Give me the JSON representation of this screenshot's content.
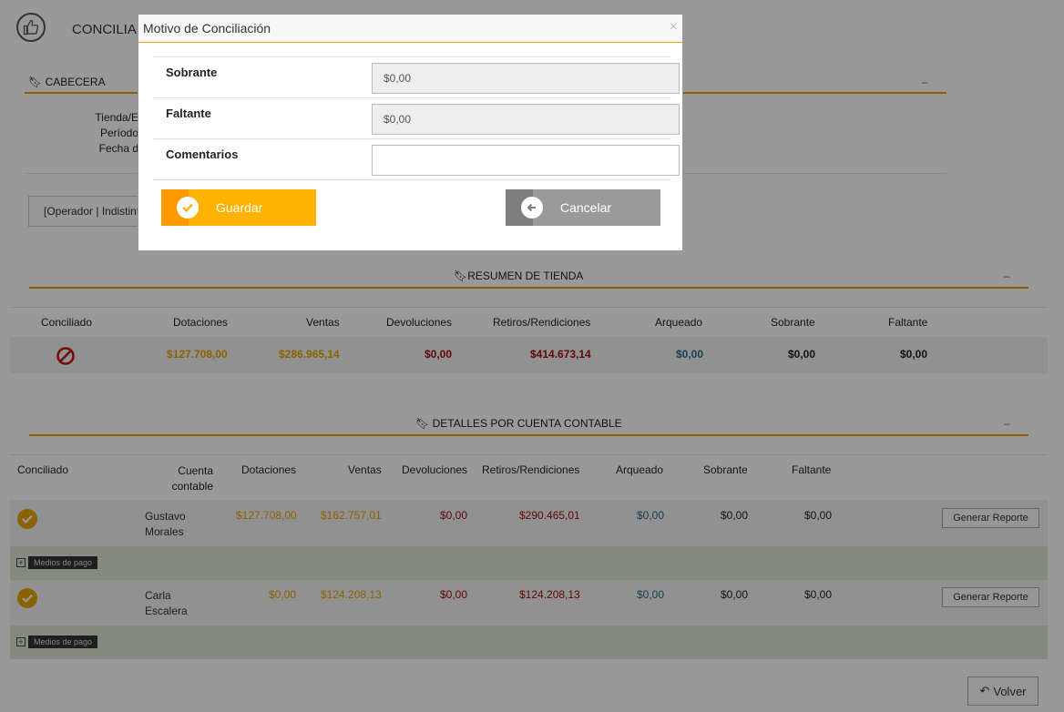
{
  "page": {
    "title": "CONCILIAR",
    "cabecera": {
      "heading": "CABECERA",
      "labels": [
        "Tienda/E",
        "Período",
        "Fecha d"
      ]
    },
    "operator_select": "[Operador | Indistinto]",
    "resumen": {
      "heading": "RESUMEN DE TIENDA",
      "headers": [
        "Conciliado",
        "Dotaciones",
        "Ventas",
        "Devoluciones",
        "Retiros/Rendiciones",
        "Arqueado",
        "Sobrante",
        "Faltante"
      ],
      "values": {
        "dotaciones": "$127.708,00",
        "ventas": "$286.965,14",
        "devoluciones": "$0,00",
        "retiros": "$414.673,14",
        "arqueado": "$0,00",
        "sobrante": "$0,00",
        "faltante": "$0,00"
      }
    },
    "detalles": {
      "heading": "DETALLES POR CUENTA CONTABLE",
      "headers": [
        "Conciliado",
        "Cuenta contable",
        "Dotaciones",
        "Ventas",
        "Devoluciones",
        "Retiros/Rendiciones",
        "Arqueado",
        "Sobrante",
        "Faltante"
      ],
      "rows": [
        {
          "cuenta": "Gustavo Morales",
          "dotaciones": "$127.708,00",
          "ventas": "$162.757,01",
          "devoluciones": "$0,00",
          "retiros": "$290.465,01",
          "arqueado": "$0,00",
          "sobrante": "$0,00",
          "faltante": "$0,00"
        },
        {
          "cuenta": "Carla Escalera",
          "dotaciones": "$0,00",
          "ventas": "$124.208,13",
          "devoluciones": "$0,00",
          "retiros": "$124.208,13",
          "arqueado": "$0,00",
          "sobrante": "$0,00",
          "faltante": "$0,00"
        }
      ],
      "generar_label": "Generar Reporte",
      "medios_label": "Medios de pago"
    },
    "volver_label": "Volver",
    "collapse_glyph": "–"
  },
  "modal": {
    "title": "Motivo de Conciliación",
    "close_glyph": "×",
    "fields": {
      "sobrante": {
        "label": "Sobrante",
        "value": "$0,00"
      },
      "faltante": {
        "label": "Faltante",
        "value": "$0,00"
      },
      "comentarios": {
        "label": "Comentarios",
        "value": ""
      }
    },
    "guardar_label": "Guardar",
    "cancelar_label": "Cancelar"
  },
  "colors": {
    "accent": "#e8a300",
    "guardar": "#ffb300",
    "cancelar": "#9a9a9a",
    "value_red": "#a01010",
    "value_blue": "#2a6a8a"
  }
}
